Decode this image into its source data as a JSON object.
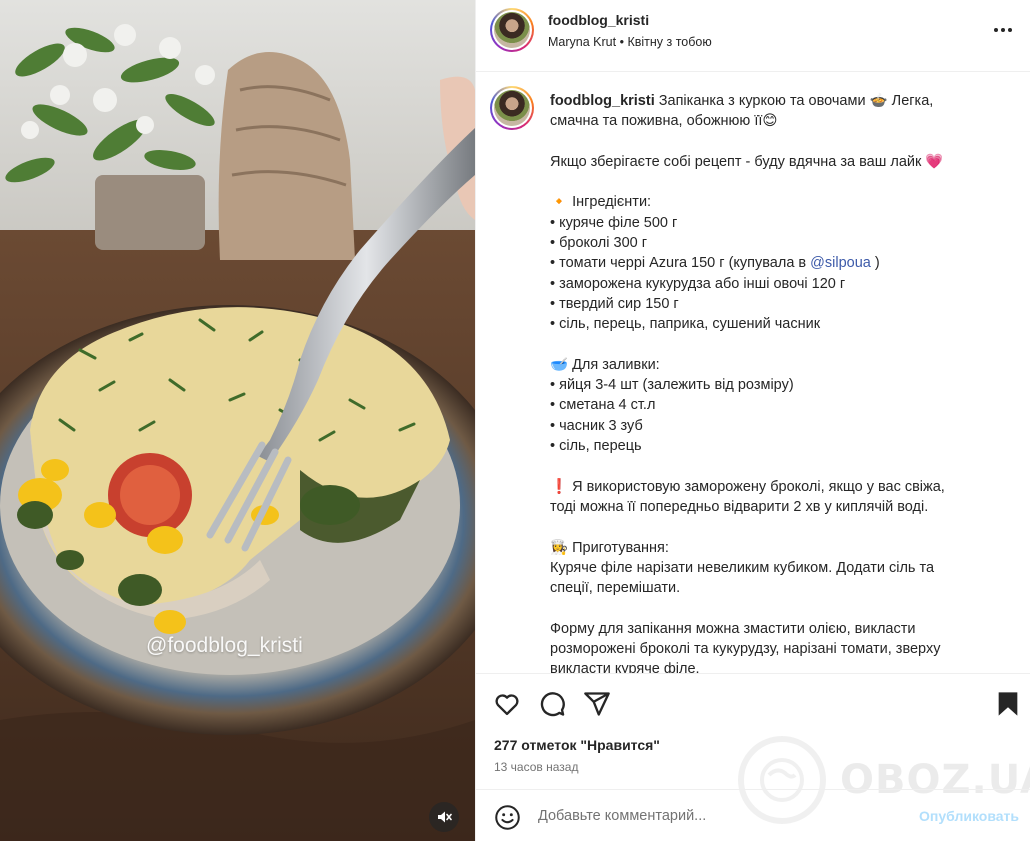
{
  "post": {
    "username": "foodblog_kristi",
    "subtitle_left": "Maryna Krut",
    "subtitle_sep": "•",
    "subtitle_right": "Квітну з тобою",
    "watermark": "@foodblog_kristi"
  },
  "caption": {
    "username": "foodblog_kristi",
    "title": " Запіканка з куркою та овочами 🍲 Легка,",
    "title_line2": "смачна та поживна, обожнюю її😊",
    "save_line": "Якщо зберігаєте собі рецепт - буду вдячна за ваш лайк 💗",
    "ingredients_header": "🔸 Інгредієнти:",
    "ingredients": [
      "• куряче філе 500 г",
      "• броколі 300 г",
      "• томати черрі Azura 150 г (купувала в ",
      "• заморожена кукурудза або інші овочі 120 г",
      "• твердий сир 150 г",
      "• сіль, перець, паприка, сушений часник"
    ],
    "mention": "@silpoua",
    "mention_close": " )",
    "filling_header": "🥣 Для заливки:",
    "filling": [
      "• яйця 3-4 шт (залежить від розміру)",
      "• сметана 4 ст.л",
      "• часник 3 зуб",
      "• сіль, перець"
    ],
    "note_line1": "❗ Я використовую заморожену броколі, якщо у вас свіжа,",
    "note_line2": "тоді можна її попередньо відварити 2 хв у киплячій воді.",
    "cooking_header": "👩‍🍳 Приготування:",
    "cooking_line1": "Куряче філе нарізати невеликим кубиком. Додати сіль та",
    "cooking_line2": "спеції, перемішати.",
    "form_line1": "Форму для запікання можна змастити олією, викласти",
    "form_line2": "розморожені броколі та кукурудзу, нарізані томати, зверху",
    "form_line3": "викласти куряче філе."
  },
  "actions": {
    "likes": "277 отметок \"Нравится\"",
    "time_ago": "13 часов назад",
    "icons": [
      "heart-icon",
      "comment-icon",
      "share-icon",
      "bookmark-icon"
    ]
  },
  "comment": {
    "placeholder": "Добавьте комментарий...",
    "publish_label": "Опубликовать"
  },
  "brand": {
    "watermark_text": "OBOZ.UA"
  },
  "colors": {
    "mention": "#3d5aa9",
    "publish_disabled": "#b2dffc",
    "secondary_text": "#737373"
  }
}
